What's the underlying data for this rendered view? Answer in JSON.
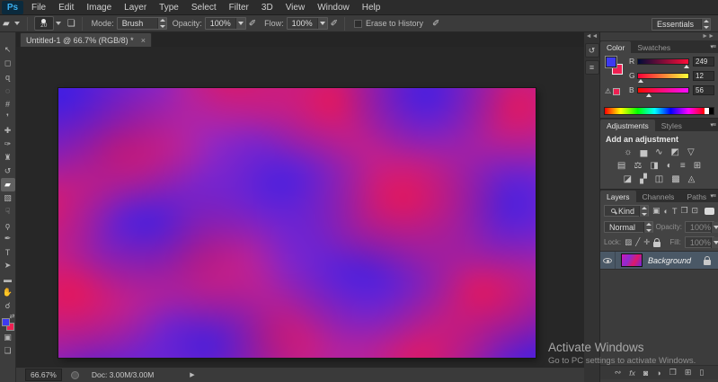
{
  "menu_bar": {
    "logo": "Ps",
    "items": [
      "File",
      "Edit",
      "Image",
      "Layer",
      "Type",
      "Select",
      "Filter",
      "3D",
      "View",
      "Window",
      "Help"
    ]
  },
  "icons": {
    "eraser_options": "▰",
    "brush_panel": "❏",
    "airbrush": "✐",
    "collapse_left": "◄◄",
    "collapse_right": "►►",
    "history_panel": "↺",
    "properties_panel": "≡",
    "gamut_warning": "⚠",
    "panel_menu": "▾≡",
    "status_arrow": "▶",
    "swap_colors": "⇄",
    "quick_mask": "▣",
    "screen_mode": "❏"
  },
  "options_bar": {
    "brush_size": "20",
    "mode_label": "Mode:",
    "mode_value": "Brush",
    "opacity_label": "Opacity:",
    "opacity_value": "100%",
    "flow_label": "Flow:",
    "flow_value": "100%",
    "erase_history_label": "Erase to History",
    "workspace": "Essentials"
  },
  "tab_bar": {
    "title": "Untitled-1 @ 66.7% (RGB/8) *",
    "close": "×"
  },
  "tools": [
    {
      "name": "move",
      "glyph": "↖"
    },
    {
      "name": "rectangular-marquee",
      "glyph": "◻"
    },
    {
      "name": "lasso",
      "glyph": "ɋ"
    },
    {
      "name": "quick-selection",
      "glyph": "◌"
    },
    {
      "name": "crop",
      "glyph": "#"
    },
    {
      "name": "eyedropper",
      "glyph": "❜"
    },
    {
      "name": "spot-healing-brush",
      "glyph": "✚"
    },
    {
      "name": "brush",
      "glyph": "✑"
    },
    {
      "name": "clone-stamp",
      "glyph": "♜"
    },
    {
      "name": "history-brush",
      "glyph": "↺"
    },
    {
      "name": "eraser",
      "glyph": "▰"
    },
    {
      "name": "gradient",
      "glyph": "▧"
    },
    {
      "name": "smudge",
      "glyph": "☟"
    },
    {
      "name": "dodge",
      "glyph": "ϙ"
    },
    {
      "name": "pen",
      "glyph": "✒"
    },
    {
      "name": "type",
      "glyph": "T"
    },
    {
      "name": "path-selection",
      "glyph": "➤"
    },
    {
      "name": "rectangle",
      "glyph": "▬"
    },
    {
      "name": "hand",
      "glyph": "✋"
    },
    {
      "name": "zoom",
      "glyph": "☌"
    }
  ],
  "tool_colors": {
    "foreground": "#3d3af0",
    "background": "#ee2052"
  },
  "canvas": {
    "zoom": "66.7%",
    "colors": {
      "red": "#ee1749",
      "blue": "#3a23dd",
      "purple": "#9a28c0"
    }
  },
  "status_bar": {
    "zoom": "66.67%",
    "doc": "Doc: 3.00M/3.00M"
  },
  "panels": {
    "color": {
      "tabs": [
        "Color",
        "Swatches"
      ],
      "channels": [
        {
          "label": "R",
          "value": "249"
        },
        {
          "label": "G",
          "value": "12"
        },
        {
          "label": "B",
          "value": "56"
        }
      ]
    },
    "adjustments": {
      "tabs": [
        "Adjustments",
        "Styles"
      ],
      "header": "Add an adjustment",
      "row1": [
        {
          "name": "brightness-contrast",
          "glyph": "☼"
        },
        {
          "name": "levels",
          "glyph": "▅"
        },
        {
          "name": "curves",
          "glyph": "∿"
        },
        {
          "name": "exposure",
          "glyph": "◩"
        },
        {
          "name": "vibrance",
          "glyph": "▽"
        }
      ],
      "row2": [
        {
          "name": "hue-saturation",
          "glyph": "▤"
        },
        {
          "name": "color-balance",
          "glyph": "⚖"
        },
        {
          "name": "black-white",
          "glyph": "◨"
        },
        {
          "name": "photo-filter",
          "glyph": "◐"
        },
        {
          "name": "channel-mixer",
          "glyph": "≡"
        },
        {
          "name": "color-lookup",
          "glyph": "⊞"
        }
      ],
      "row3": [
        {
          "name": "invert",
          "glyph": "◪"
        },
        {
          "name": "posterize",
          "glyph": "▞"
        },
        {
          "name": "threshold",
          "glyph": "◫"
        },
        {
          "name": "gradient-map",
          "glyph": "▩"
        },
        {
          "name": "selective-color",
          "glyph": "◬"
        }
      ]
    },
    "layers": {
      "tabs": [
        "Layers",
        "Channels",
        "Paths"
      ],
      "kind_label": "Kind",
      "filter_icons": [
        {
          "name": "filter-pixel-layers",
          "glyph": "▣"
        },
        {
          "name": "filter-adjustment-layers",
          "glyph": "◐"
        },
        {
          "name": "filter-type-layers",
          "glyph": "T"
        },
        {
          "name": "filter-shape-layers",
          "glyph": "❒"
        },
        {
          "name": "filter-smart-objects",
          "glyph": "⊡"
        }
      ],
      "blend_mode": "Normal",
      "opacity_label": "Opacity:",
      "opacity_value": "100%",
      "lock_label": "Lock:",
      "lock_icons": [
        {
          "name": "lock-transparent-pixels",
          "glyph": "▨"
        },
        {
          "name": "lock-image-pixels",
          "glyph": "╱"
        },
        {
          "name": "lock-position",
          "glyph": "✛"
        }
      ],
      "fill_label": "Fill:",
      "fill_value": "100%",
      "layer_name": "Background",
      "actions": [
        {
          "name": "link-layers",
          "glyph": "∾"
        },
        {
          "name": "layer-effects",
          "glyph": "fx"
        },
        {
          "name": "add-layer-mask",
          "glyph": "◙"
        },
        {
          "name": "new-adjustment-layer",
          "glyph": "◑"
        },
        {
          "name": "new-group",
          "glyph": "❒"
        },
        {
          "name": "new-layer",
          "glyph": "⊞"
        },
        {
          "name": "delete-layer",
          "glyph": "▯"
        }
      ]
    }
  },
  "watermark": {
    "line1": "Activate Windows",
    "line2": "Go to PC settings to activate Windows."
  }
}
